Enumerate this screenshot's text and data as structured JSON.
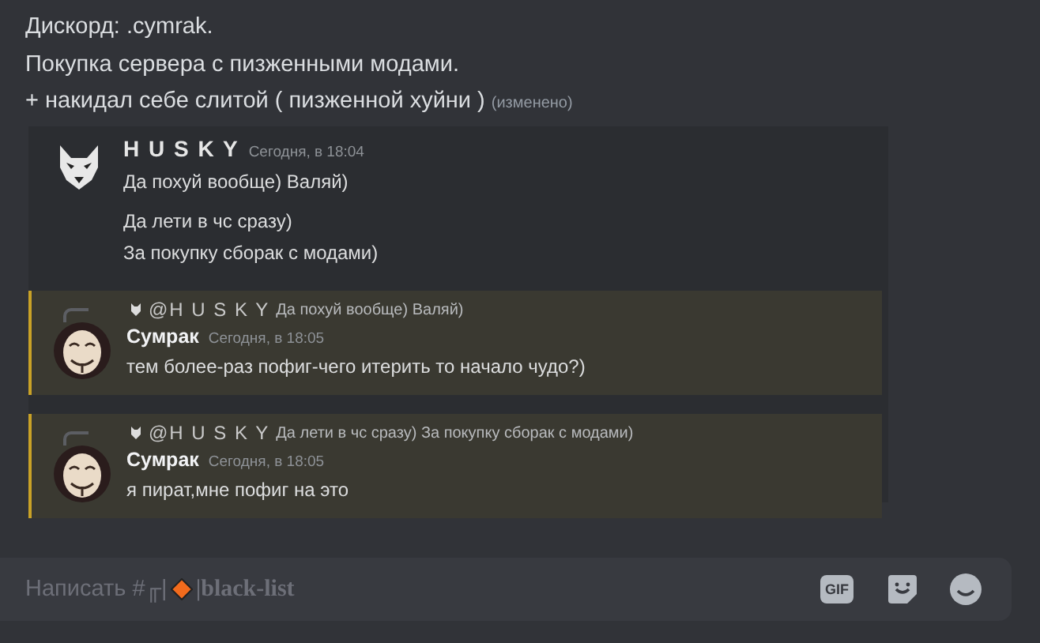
{
  "message": {
    "lines": [
      "Дискорд: .cymrak.",
      "Покупка сервера с пизженными модами."
    ],
    "last_line": "+ накидал себе слитой ( пизженной хуйни )",
    "edited": "(изменено)"
  },
  "screenshot": {
    "author": "H U S K Y",
    "time": "Сегодня, в 18:04",
    "lines": [
      "Да похуй вообще) Валяй)",
      "Да лети в чс сразу)",
      "За покупку сборак с модами)"
    ],
    "replies": [
      {
        "reply_to": "@H U S K Y",
        "quote": "Да похуй вообще) Валяй)",
        "author": "Сумрак",
        "time": "Сегодня, в 18:05",
        "text": "тем более-раз пофиг-чего итерить то начало чудо?)",
        "highlighted": true
      },
      {
        "reply_to": "@H U S K Y",
        "quote": "Да лети в чс сразу) За покупку сборак с модами)",
        "author": "Сумрак",
        "time": "Сегодня, в 18:05",
        "text": "я пират,мне пофиг на это",
        "highlighted": true
      }
    ]
  },
  "composer": {
    "placeholder_prefix": "Написать #╓|",
    "channel": "|black-list",
    "gif_label": "GIF"
  }
}
